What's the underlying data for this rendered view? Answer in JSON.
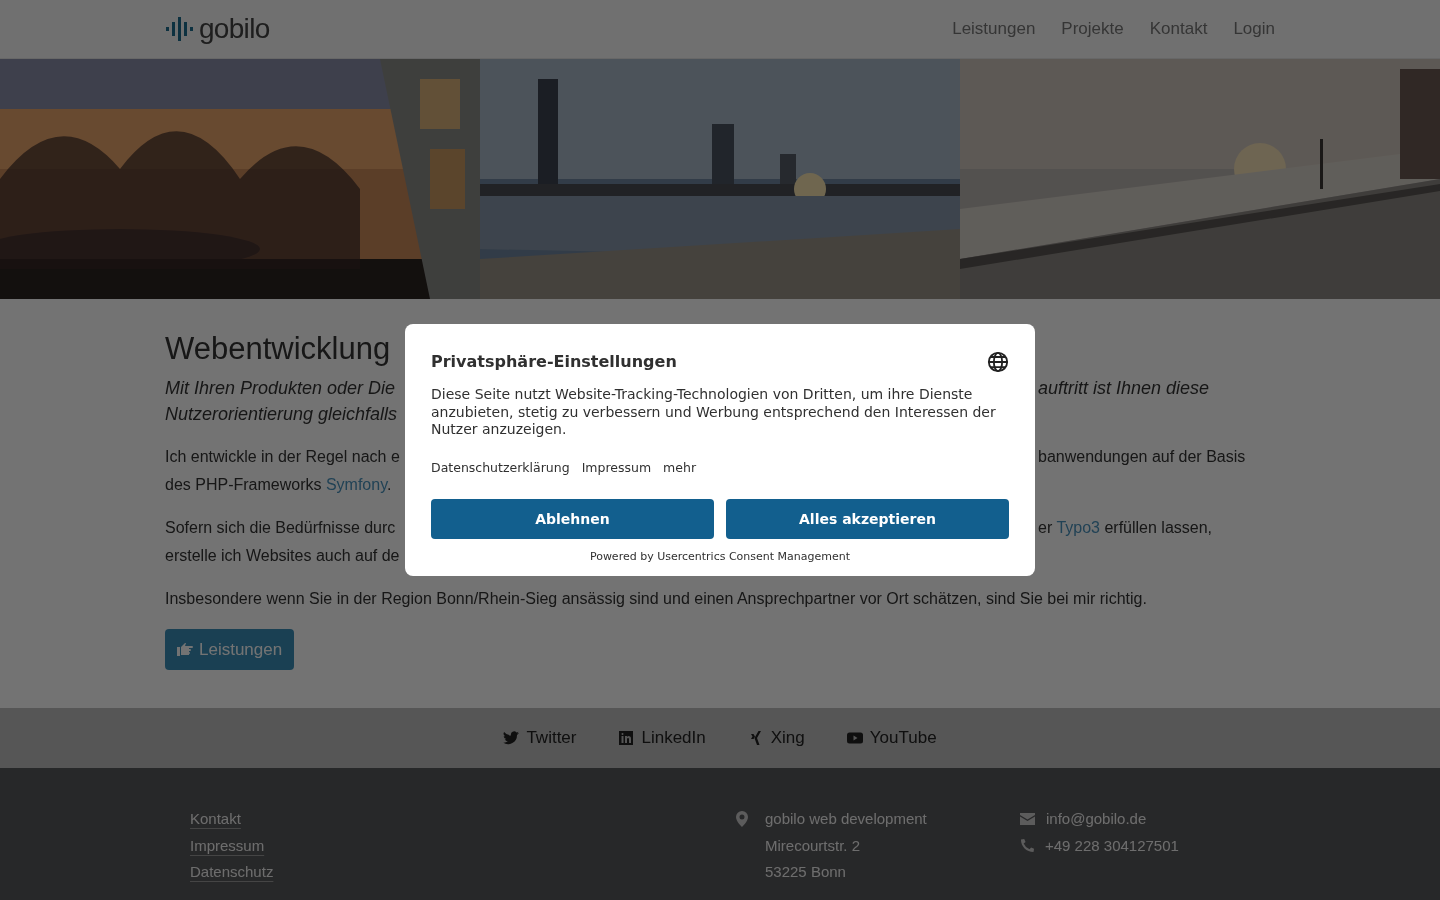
{
  "header": {
    "logo": "gobilo",
    "nav": [
      "Leistungen",
      "Projekte",
      "Kontakt",
      "Login"
    ]
  },
  "content": {
    "heading": "Webentwicklung",
    "intro": [
      {
        "left": [
          {
            "text": "Mit Ihren Produkten oder Die"
          }
        ],
        "right": [
          {
            "text": "auftritt ist Ihnen diese"
          }
        ]
      },
      {
        "left": [
          {
            "text": "Nutzerorientierung gleichfalls"
          }
        ]
      }
    ],
    "paragraphs": [
      [
        {
          "left": [
            {
              "text": "Ich entwickle in der Regel nach e"
            }
          ],
          "right": [
            {
              "text": "banwendungen auf der Basis"
            }
          ]
        },
        {
          "left": [
            {
              "text": "des PHP-Frameworks "
            },
            {
              "text": "Symfony",
              "link": true
            },
            {
              "text": "."
            }
          ]
        }
      ],
      [
        {
          "left": [
            {
              "text": "Sofern sich die Bedürfnisse durc"
            }
          ],
          "right": [
            {
              "text": "er "
            },
            {
              "text": "Typo3",
              "link": true
            },
            {
              "text": " erfüllen lassen,"
            }
          ]
        },
        {
          "left": [
            {
              "text": "erstelle ich Websites auch auf de"
            }
          ]
        }
      ],
      [
        {
          "left": [
            {
              "text": "Insbesondere wenn Sie in der Region Bonn/Rhein-Sieg ansässig sind und einen Ansprechpartner vor Ort schätzen, sind Sie bei mir richtig."
            }
          ]
        }
      ]
    ],
    "button": "Leistungen"
  },
  "social": [
    {
      "kind": "twitter",
      "label": "Twitter"
    },
    {
      "kind": "linkedin",
      "label": "LinkedIn"
    },
    {
      "kind": "xing",
      "label": "Xing"
    },
    {
      "kind": "youtube",
      "label": "YouTube"
    }
  ],
  "footer": {
    "links": [
      "Kontakt",
      "Impressum",
      "Datenschutz"
    ],
    "address": [
      "gobilo web development",
      "Mirecourtstr. 2",
      "53225 Bonn"
    ],
    "email": "info@gobilo.de",
    "phone": "+49 228 304127501"
  },
  "consent": {
    "title": "Privatsphäre-Einstellungen",
    "text": "Diese Seite nutzt Website-Tracking-Technologien von Dritten, um ihre Dienste anzubieten, stetig zu verbessern und Werbung entsprechend den Interessen der Nutzer anzuzeigen.",
    "links": [
      "Datenschutzerklärung",
      "Impressum",
      "mehr"
    ],
    "buttons": [
      "Ablehnen",
      "Alles akzeptieren"
    ],
    "powered_by": "Powered by Usercentrics Consent Management"
  }
}
